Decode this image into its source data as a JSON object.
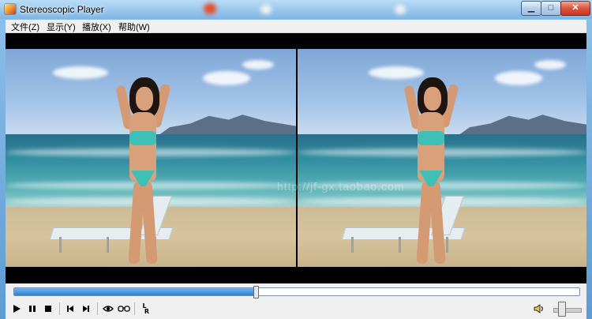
{
  "window": {
    "title": "Stereoscopic Player",
    "minimize_glyph": "▁",
    "maximize_glyph": "□",
    "close_glyph": "✕"
  },
  "menu": {
    "items": [
      {
        "label": "文件(Z)"
      },
      {
        "label": "显示(Y)"
      },
      {
        "label": "播放(X)"
      },
      {
        "label": "帮助(W)"
      }
    ]
  },
  "video": {
    "layout": "side-by-side",
    "watermark_text": "http://jf-gx.taobao.com"
  },
  "playback": {
    "progress_fraction": 0.428,
    "volume_fraction": 0.3
  },
  "toolbar": {
    "icons": [
      "play-icon",
      "pause-icon",
      "stop-icon",
      "previous-icon",
      "next-icon",
      "eye-icon",
      "glasses-icon",
      "lr-swap-icon",
      "volume-icon"
    ],
    "lr_label_top": "L",
    "lr_label_bottom": "R"
  },
  "colors": {
    "accent": "#2e7fd0",
    "menu_bg": "#f0f0f0",
    "close_button": "#d9553c"
  }
}
